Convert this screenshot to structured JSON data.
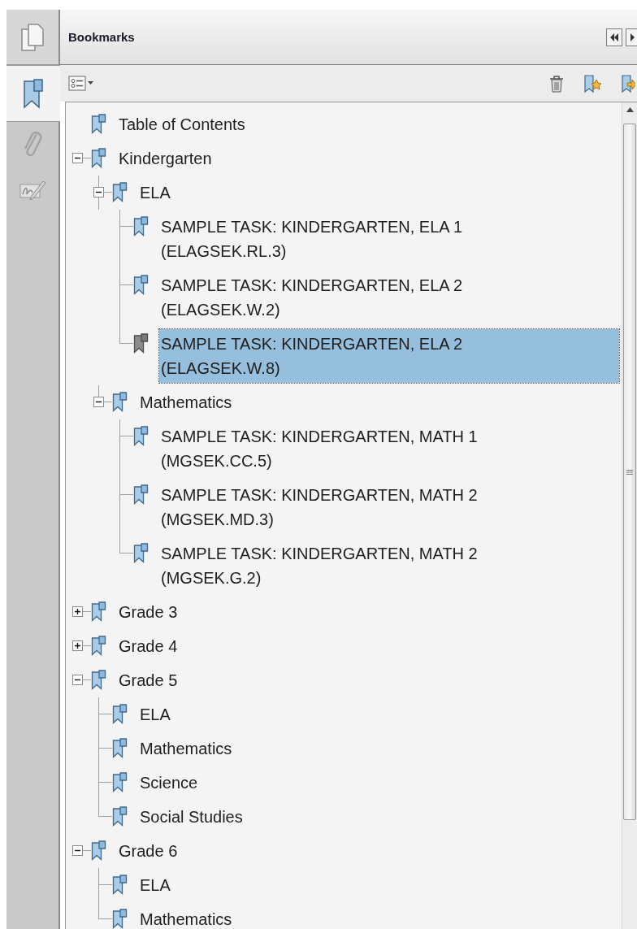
{
  "rail": {
    "tabs": [
      {
        "kind": "pages",
        "selected": false
      },
      {
        "kind": "bookmarks",
        "selected": true
      },
      {
        "kind": "attachments",
        "selected": false
      },
      {
        "kind": "signatures",
        "selected": false
      }
    ]
  },
  "panel": {
    "title": "Bookmarks"
  },
  "tree": {
    "items": [
      {
        "label": "Table of Contents",
        "selected": false
      },
      {
        "label": "Kindergarten",
        "selected": false,
        "expanded": true,
        "children": [
          {
            "label": "ELA",
            "selected": false,
            "expanded": true,
            "children": [
              {
                "label": "SAMPLE TASK: KINDERGARTEN, ELA 1 (ELAGSEK.RL.3)",
                "selected": false
              },
              {
                "label": "SAMPLE TASK: KINDERGARTEN, ELA 2 (ELAGSEK.W.2)",
                "selected": false
              },
              {
                "label": "SAMPLE TASK: KINDERGARTEN, ELA 2 (ELAGSEK.W.8)",
                "selected": true
              }
            ]
          },
          {
            "label": "Mathematics",
            "selected": false,
            "expanded": true,
            "children": [
              {
                "label": "SAMPLE TASK: KINDERGARTEN, MATH 1 (MGSEK.CC.5)",
                "selected": false
              },
              {
                "label": "SAMPLE TASK: KINDERGARTEN, MATH 2 (MGSEK.MD.3)",
                "selected": false
              },
              {
                "label": "SAMPLE TASK: KINDERGARTEN, MATH 2 (MGSEK.G.2)",
                "selected": false
              }
            ]
          }
        ]
      },
      {
        "label": "Grade 3",
        "selected": false,
        "expanded": false
      },
      {
        "label": "Grade 4",
        "selected": false,
        "expanded": false
      },
      {
        "label": "Grade 5",
        "selected": false,
        "expanded": true,
        "children": [
          {
            "label": "ELA",
            "selected": false
          },
          {
            "label": "Mathematics",
            "selected": false
          },
          {
            "label": "Science",
            "selected": false
          },
          {
            "label": "Social Studies",
            "selected": false
          }
        ]
      },
      {
        "label": "Grade 6",
        "selected": false,
        "expanded": true,
        "children": [
          {
            "label": "ELA",
            "selected": false
          },
          {
            "label": "Mathematics",
            "selected": false
          }
        ]
      }
    ]
  }
}
